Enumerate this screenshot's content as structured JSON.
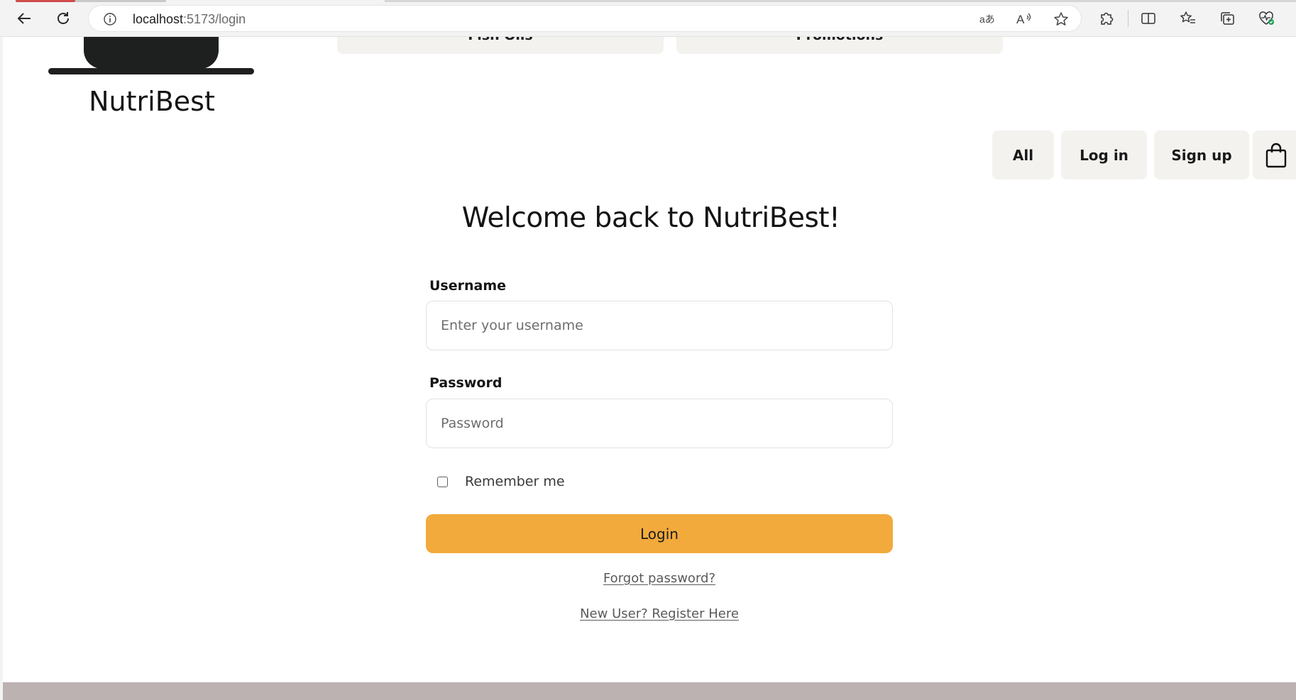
{
  "browser": {
    "url_host": "localhost",
    "url_path": ":5173/login",
    "icons": {
      "back": "back-arrow-icon",
      "refresh": "refresh-icon",
      "info": "info-icon",
      "translate": "translate-icon",
      "read_aloud": "read-aloud-icon",
      "favorite": "star-icon",
      "extensions": "puzzle-icon",
      "split_screen": "split-screen-icon",
      "favorites_list": "favorites-list-icon",
      "collections": "collections-icon",
      "health": "heartbeat-icon"
    }
  },
  "header": {
    "brand": "NutriBest",
    "category_tabs": [
      "Fish Oils",
      "Promotions"
    ],
    "nav": {
      "all_label": "All",
      "login_label": "Log in",
      "signup_label": "Sign up"
    }
  },
  "login": {
    "title": "Welcome back to NutriBest!",
    "username_label": "Username",
    "username_placeholder": "Enter your username",
    "password_label": "Password",
    "password_placeholder": "Password",
    "remember_label": "Remember me",
    "remember_checked": false,
    "submit_label": "Login",
    "forgot_link": "Forgot password?",
    "register_link": "New User? Register Here"
  },
  "colors": {
    "accent": "#f2aa3c",
    "button_bg": "#f3f2ef",
    "logo": "#1e1f1f",
    "footer": "#bcb2b2"
  }
}
